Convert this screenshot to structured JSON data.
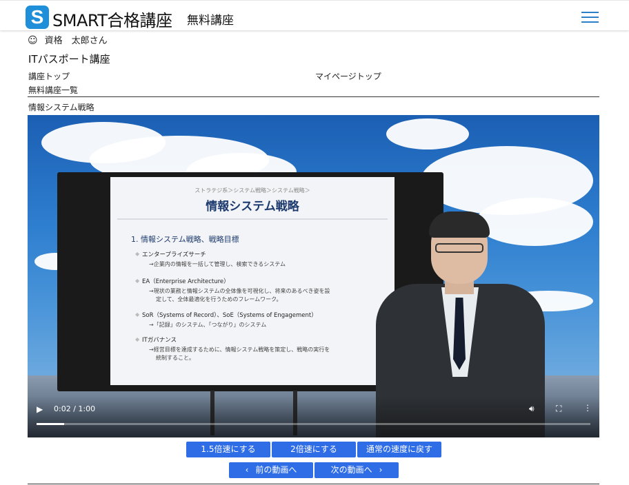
{
  "header": {
    "logo_letter": "S",
    "brand": "SMART合格講座",
    "section": "無料講座",
    "menu_icon": "hamburger-icon",
    "accent_color": "#1e8fd8"
  },
  "user": {
    "icon": "smile-icon",
    "greeting": "資格　太郎さん"
  },
  "course_title": "ITパスポート講座",
  "nav": {
    "course_top": "講座トップ",
    "mypage_top": "マイページトップ",
    "free_list": "無料講座一覧"
  },
  "lesson_title": "情報システム戦略",
  "video": {
    "current_time": "0:02",
    "duration": "1:00",
    "time_label": "0:02 / 1:00",
    "progress": 0.05,
    "slide": {
      "breadcrumb": "ストラテジ系＞システム戦略＞システム戦略＞",
      "title": "情報システム戦略",
      "heading": "1. 情報システム戦略、戦略目標",
      "items": [
        {
          "label": "エンタープライズサーチ",
          "desc": [
            "→企業内の情報を一括して管理し、検索できるシステム"
          ]
        },
        {
          "label": "EA（Enterprise Architecture）",
          "desc": [
            "→現状の業務と情報システムの全体像を可視化し、将来のあるべき姿を設",
            "定して、全体最適化を行うためのフレームワーク。"
          ]
        },
        {
          "label": "SoR（Systems of Record）、SoE（Systems of Engagement）",
          "desc": [
            "→「記録」のシステム、「つながり」のシステム"
          ]
        },
        {
          "label": "ITガバナンス",
          "desc": [
            "→経営目標を達成するために、情報システム戦略を策定し、戦略の実行を",
            "統制すること。"
          ]
        }
      ]
    }
  },
  "buttons": {
    "speed_15": "1.5倍速にする",
    "speed_2": "2倍速にする",
    "speed_normal": "通常の速度に戻す",
    "prev": "前の動画へ",
    "next": "次の動画へ",
    "button_color": "#2f6de6"
  }
}
